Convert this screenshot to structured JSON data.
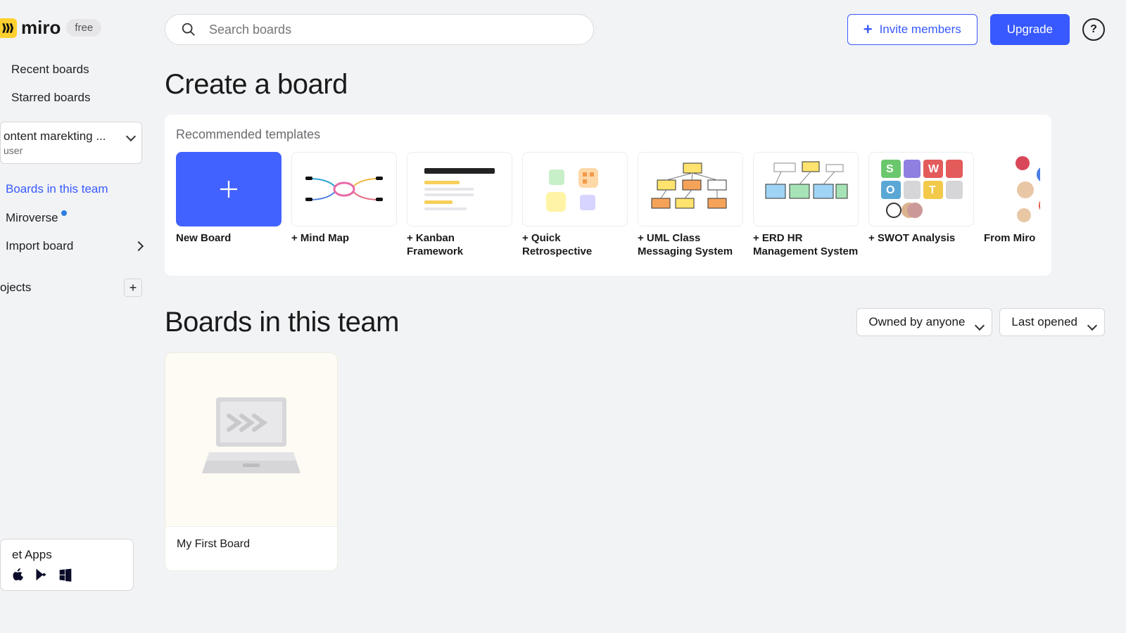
{
  "brand": {
    "name": "miro",
    "plan": "free"
  },
  "header": {
    "search_placeholder": "Search boards",
    "invite_label": "Invite members",
    "upgrade_label": "Upgrade"
  },
  "sidebar": {
    "recent": "Recent boards",
    "starred": "Starred boards",
    "team_name": "ontent marekting ...",
    "team_role": "user",
    "boards_in_team": "Boards in this team",
    "miroverse": "Miroverse",
    "import_board": "Import board",
    "projects_label": "ojects",
    "get_apps": "et Apps"
  },
  "create": {
    "title": "Create a board",
    "subtitle": "Recommended templates",
    "templates": [
      {
        "label": "New Board"
      },
      {
        "label": "+ Mind Map"
      },
      {
        "label": "+ Kanban Framework"
      },
      {
        "label": "+ Quick Retrospective"
      },
      {
        "label": "+ UML Class Messaging System"
      },
      {
        "label": "+ ERD HR Management System"
      },
      {
        "label": "+ SWOT Analysis"
      },
      {
        "label": "From Miro"
      }
    ]
  },
  "boards": {
    "title": "Boards in this team",
    "filter_owner": "Owned by anyone",
    "filter_sort": "Last opened",
    "items": [
      {
        "name": "My First Board"
      }
    ]
  }
}
